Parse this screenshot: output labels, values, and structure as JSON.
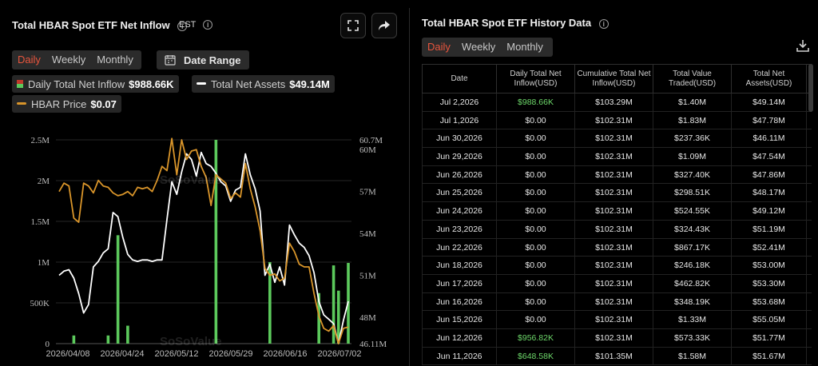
{
  "left_panel": {
    "title": "Total HBAR Spot ETF Net Inflow",
    "timezone": "EST",
    "tabs": [
      "Daily",
      "Weekly",
      "Monthly"
    ],
    "active_tab": "Daily",
    "date_range_label": "Date Range",
    "legend": [
      {
        "label": "Daily Total Net Inflow",
        "value": "$988.66K",
        "color": "#5cc95c"
      },
      {
        "label": "Total Net Assets",
        "value": "$49.14M",
        "color": "#ffffff"
      },
      {
        "label": "HBAR Price",
        "value": "$0.07",
        "color": "#d9952a"
      }
    ],
    "watermark": "SoSoValue"
  },
  "right_panel": {
    "title": "Total HBAR Spot ETF History Data",
    "tabs": [
      "Daily",
      "Weekly",
      "Monthly"
    ],
    "active_tab": "Daily",
    "columns": [
      "Date",
      "Daily Total Net Inflow(USD)",
      "Cumulative Total Net Inflow(USD)",
      "Total Value Traded(USD)",
      "Total Net Assets(USD)"
    ],
    "rows": [
      [
        "Jul 2,2026",
        "$988.66K",
        "$103.29M",
        "$1.40M",
        "$49.14M"
      ],
      [
        "Jul 1,2026",
        "$0.00",
        "$102.31M",
        "$1.83M",
        "$47.78M"
      ],
      [
        "Jun 30,2026",
        "$0.00",
        "$102.31M",
        "$237.36K",
        "$46.11M"
      ],
      [
        "Jun 29,2026",
        "$0.00",
        "$102.31M",
        "$1.09M",
        "$47.54M"
      ],
      [
        "Jun 26,2026",
        "$0.00",
        "$102.31M",
        "$327.40K",
        "$47.86M"
      ],
      [
        "Jun 25,2026",
        "$0.00",
        "$102.31M",
        "$298.51K",
        "$48.17M"
      ],
      [
        "Jun 24,2026",
        "$0.00",
        "$102.31M",
        "$524.55K",
        "$49.12M"
      ],
      [
        "Jun 23,2026",
        "$0.00",
        "$102.31M",
        "$324.43K",
        "$51.19M"
      ],
      [
        "Jun 22,2026",
        "$0.00",
        "$102.31M",
        "$867.17K",
        "$52.41M"
      ],
      [
        "Jun 18,2026",
        "$0.00",
        "$102.31M",
        "$246.18K",
        "$53.00M"
      ],
      [
        "Jun 17,2026",
        "$0.00",
        "$102.31M",
        "$462.82K",
        "$53.30M"
      ],
      [
        "Jun 16,2026",
        "$0.00",
        "$102.31M",
        "$348.19K",
        "$53.68M"
      ],
      [
        "Jun 15,2026",
        "$0.00",
        "$102.31M",
        "$1.33M",
        "$55.05M"
      ],
      [
        "Jun 12,2026",
        "$956.82K",
        "$102.31M",
        "$573.33K",
        "$51.77M"
      ],
      [
        "Jun 11,2026",
        "$648.58K",
        "$101.35M",
        "$1.58M",
        "$51.67M"
      ]
    ],
    "green_values": [
      "$988.66K",
      "$956.82K",
      "$648.58K"
    ]
  },
  "chart_data": {
    "type": "bar+line",
    "x_tick_labels": [
      "2026/04/08",
      "2026/04/24",
      "2026/05/12",
      "2026/05/29",
      "2026/06/16",
      "2026/07/02"
    ],
    "y_left_ticks": [
      "0",
      "500K",
      "1M",
      "1.5M",
      "2M",
      "2.5M"
    ],
    "y_left_range": [
      0,
      2500000
    ],
    "y_right_ticks": [
      "46.11M",
      "48M",
      "51M",
      "54M",
      "57M",
      "60M",
      "60.7M"
    ],
    "y_right_range": [
      46.11,
      60.7
    ],
    "grid": "horizontal",
    "x_count": 60,
    "series": [
      {
        "name": "Daily Total Net Inflow",
        "kind": "bar",
        "color": "#5cc95c",
        "points": [
          [
            3,
            100000
          ],
          [
            10,
            100000
          ],
          [
            12,
            1330000
          ],
          [
            14,
            220000
          ],
          [
            32,
            2500000
          ],
          [
            43,
            1000000
          ],
          [
            53,
            620000
          ],
          [
            56,
            960000
          ],
          [
            57,
            650000
          ],
          [
            59,
            990000
          ]
        ]
      },
      {
        "name": "Total Net Assets",
        "kind": "line",
        "color": "#ffffff",
        "values": [
          51.0,
          51.3,
          51.4,
          50.8,
          49.7,
          48.3,
          48.9,
          51.6,
          52.0,
          52.6,
          52.9,
          55.5,
          55.2,
          53.7,
          52.5,
          52.1,
          52.0,
          52.1,
          52.1,
          52.0,
          52.1,
          52.1,
          55.0,
          57.7,
          56.8,
          58.4,
          59.7,
          59.3,
          58.1,
          59.8,
          59.0,
          58.8,
          58.3,
          57.7,
          57.4,
          56.3,
          57.1,
          57.3,
          59.7,
          58.2,
          57.2,
          55.6,
          51.0,
          51.8,
          50.5,
          51.6,
          50.3,
          54.6,
          53.9,
          53.3,
          53.0,
          52.41,
          51.19,
          49.12,
          48.17,
          47.86,
          47.54,
          46.11,
          47.78,
          49.14
        ]
      },
      {
        "name": "HBAR Price",
        "kind": "line",
        "color": "#d9952a",
        "values": [
          57.0,
          57.6,
          57.4,
          55.1,
          54.8,
          57.6,
          57.4,
          56.9,
          57.8,
          57.4,
          57.3,
          56.9,
          56.7,
          56.8,
          57.0,
          56.7,
          57.3,
          57.2,
          57.3,
          57.0,
          57.8,
          58.8,
          58.5,
          60.8,
          58.2,
          60.7,
          59.3,
          59.9,
          60.0,
          58.8,
          58.0,
          56.0,
          58.2,
          57.9,
          57.6,
          56.5,
          56.9,
          56.6,
          59.0,
          57.2,
          55.9,
          54.2,
          51.5,
          51.0,
          51.1,
          50.6,
          50.8,
          53.3,
          52.7,
          51.8,
          51.6,
          51.6,
          49.7,
          48.1,
          47.2,
          47.0,
          47.4,
          46.11,
          47.2,
          47.3
        ]
      }
    ]
  }
}
